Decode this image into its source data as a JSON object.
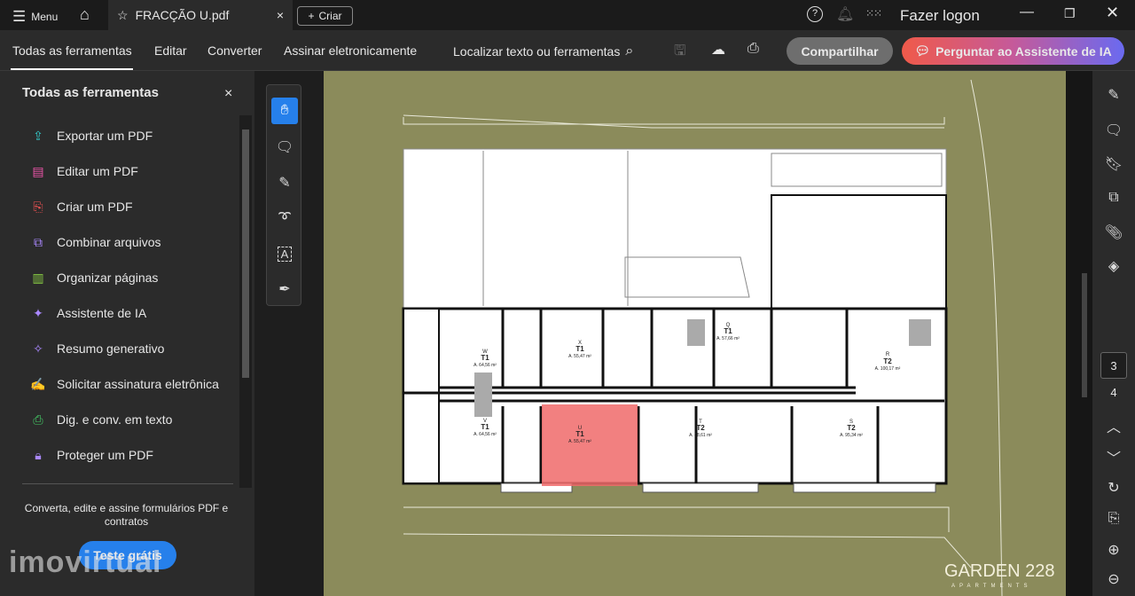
{
  "topbar": {
    "menu_label": "Menu",
    "tab_title": "FRACÇÃO U.pdf",
    "create_label": "Criar",
    "login_label": "Fazer logon"
  },
  "toolbar": {
    "tabs": [
      "Todas as ferramentas",
      "Editar",
      "Converter",
      "Assinar eletronicamente"
    ],
    "search_label": "Localizar texto ou ferramentas",
    "share_label": "Compartilhar",
    "ai_label": "Perguntar ao Assistente de IA"
  },
  "panel": {
    "title": "Todas as ferramentas",
    "tools": [
      "Exportar um PDF",
      "Editar um PDF",
      "Criar um PDF",
      "Combinar arquivos",
      "Organizar páginas",
      "Assistente de IA",
      "Resumo generativo",
      "Solicitar assinatura eletrônica",
      "Dig. e conv. em texto",
      "Proteger um PDF"
    ],
    "promo_text": "Converta, edite e assine formulários PDF e contratos",
    "trial_label": "Teste grátis"
  },
  "watermark": "imovirtual",
  "page_nav": {
    "current": "3",
    "next": "4"
  },
  "plan": {
    "logo": "GARDEN 228",
    "logo_sub": "APARTMENTS",
    "units": [
      {
        "id": "W",
        "type": "T1",
        "area": "A. 64,56 m²"
      },
      {
        "id": "X",
        "type": "T1",
        "area": "A. 55,47 m²"
      },
      {
        "id": "Q",
        "type": "T1",
        "area": "A. 57,66 m²"
      },
      {
        "id": "R",
        "type": "T2",
        "area": "A. 100,17 m²"
      },
      {
        "id": "V",
        "type": "T1",
        "area": "A. 64,56 m²"
      },
      {
        "id": "U",
        "type": "T1",
        "area": "A. 55,47 m²"
      },
      {
        "id": "T",
        "type": "T2",
        "area": "A. 88,61 m²"
      },
      {
        "id": "S",
        "type": "T2",
        "area": "A. 95,34 m²"
      }
    ],
    "highlight_color": "#f06a6a"
  }
}
